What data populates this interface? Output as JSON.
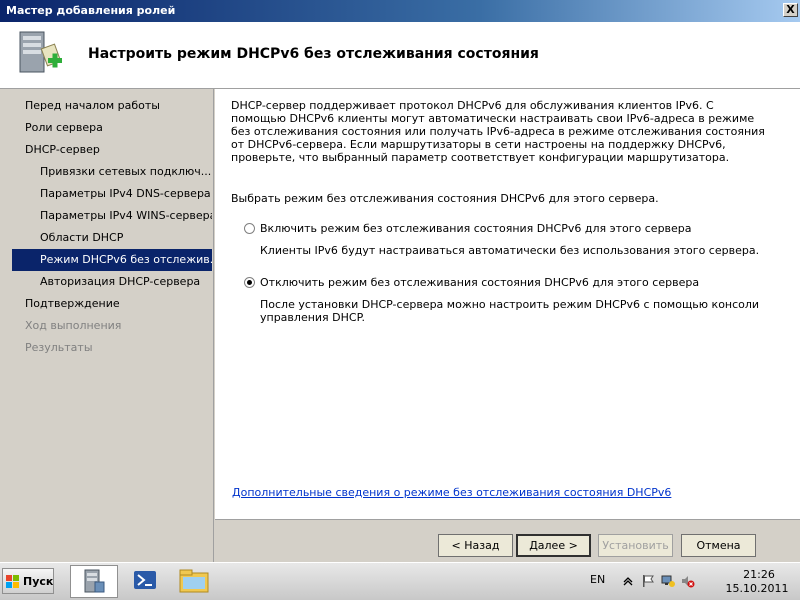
{
  "window": {
    "title": "Мастер добавления ролей",
    "close_glyph": "X"
  },
  "header": {
    "title": "Настроить режим DHCPv6 без отслеживания состояния",
    "icon": "server-add-icon"
  },
  "nav": {
    "items": [
      {
        "label": "Перед началом работы",
        "state": "normal"
      },
      {
        "label": "Роли сервера",
        "state": "normal"
      },
      {
        "label": "DHCP-сервер",
        "state": "normal"
      },
      {
        "label": "Привязки сетевых подключ...",
        "state": "sub"
      },
      {
        "label": "Параметры IPv4 DNS-сервера",
        "state": "sub"
      },
      {
        "label": "Параметры IPv4 WINS-сервера",
        "state": "sub"
      },
      {
        "label": "Области DHCP",
        "state": "sub"
      },
      {
        "label": "Режим DHCPv6 без отслежив...",
        "state": "active"
      },
      {
        "label": "Авторизация DHCP-сервера",
        "state": "sub"
      },
      {
        "label": "Подтверждение",
        "state": "normal"
      },
      {
        "label": "Ход выполнения",
        "state": "disabled"
      },
      {
        "label": "Результаты",
        "state": "disabled"
      }
    ]
  },
  "main": {
    "description": "DHCP-сервер поддерживает протокол DHCPv6 для обслуживания клиентов IPv6. С помощью DHCPv6 клиенты могут автоматически настраивать свои IPv6-адреса в режиме без отслеживания состояния или получать IPv6-адреса в режиме отслеживания состояния от DHCPv6-сервера. Если маршрутизаторы в сети настроены на поддержку DHCPv6, проверьте, что выбранный параметр соответствует конфигурации маршрутизатора.",
    "select_label": "Выбрать режим без отслеживания состояния DHCPv6 для этого сервера.",
    "option_enable": {
      "label": "Включить режим без отслеживания состояния DHCPv6 для этого сервера",
      "desc": "Клиенты IPv6 будут настраиваться автоматически без использования этого сервера.",
      "checked": false
    },
    "option_disable": {
      "label": "Отключить режим без отслеживания состояния DHCPv6 для этого сервера",
      "desc": "После установки DHCP-сервера можно настроить режим DHCPv6 с помощью консоли управления DHCP.",
      "checked": true
    },
    "link": "Дополнительные сведения о режиме без отслеживания состояния DHCPv6"
  },
  "buttons": {
    "back": "< Назад",
    "next": "Далее >",
    "install": "Установить",
    "cancel": "Отмена"
  },
  "taskbar": {
    "start": "Пуск",
    "lang": "EN",
    "time": "21:26",
    "date": "15.10.2011"
  },
  "colors": {
    "selection": "#0a246a",
    "link": "#0033cc",
    "titlebar": "#0a246a"
  }
}
